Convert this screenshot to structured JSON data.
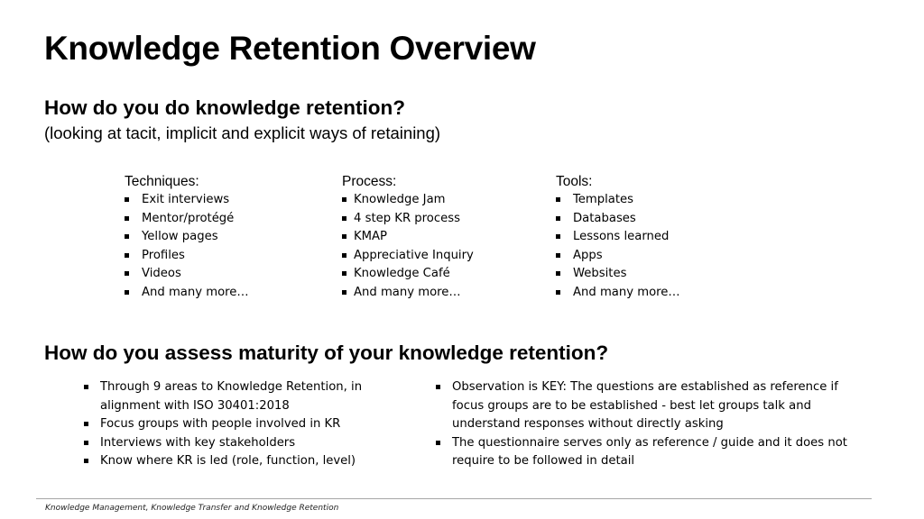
{
  "slide": {
    "title": "Knowledge Retention Overview",
    "section1": {
      "heading": "How do you do knowledge retention?",
      "subheading": "(looking at tacit, implicit and explicit ways of retaining)",
      "columns": [
        {
          "header": "Techniques:",
          "items": [
            "Exit interviews",
            "Mentor/protégé",
            "Yellow pages",
            "Profiles",
            "Videos",
            "And many more…"
          ]
        },
        {
          "header": "Process:",
          "items": [
            "Knowledge Jam",
            "4 step KR process",
            "KMAP",
            "Appreciative Inquiry",
            "Knowledge Café",
            "And many more…"
          ]
        },
        {
          "header": "Tools:",
          "items": [
            "Templates",
            "Databases",
            "Lessons learned",
            "Apps",
            "Websites",
            "And many more…"
          ]
        }
      ]
    },
    "section2": {
      "heading": "How do you assess maturity of your knowledge retention?",
      "left_items": [
        "Through 9 areas to Knowledge Retention, in alignment with ISO 30401:2018",
        "Focus groups with people involved in KR",
        "Interviews with key stakeholders",
        "Know where KR is led (role, function, level)"
      ],
      "right_items": [
        "Observation is KEY: The questions are established as reference if focus groups are to be established - best let groups talk and understand responses without directly asking",
        "The questionnaire serves only as reference / guide and it does not require to be followed in detail"
      ]
    },
    "footer": "Knowledge Management, Knowledge Transfer and Knowledge Retention"
  }
}
